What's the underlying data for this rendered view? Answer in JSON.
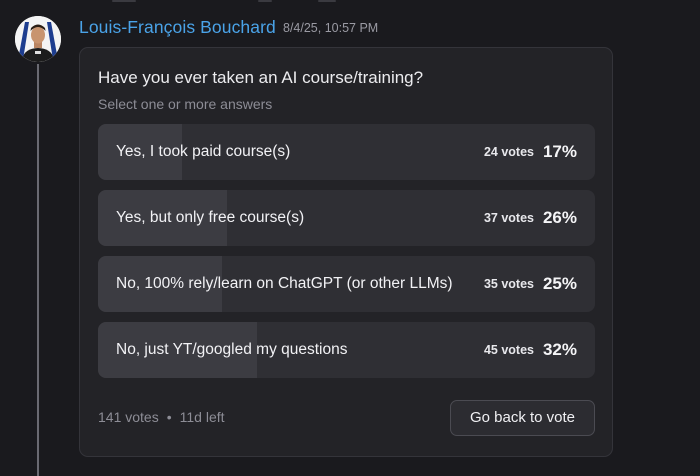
{
  "message": {
    "author": "Louis-François Bouchard",
    "timestamp": "8/4/25, 10:57 PM"
  },
  "poll": {
    "question": "Have you ever taken an AI course/training?",
    "subtitle": "Select one or more answers",
    "options": [
      {
        "label": "Yes, I took paid course(s)",
        "votes": "24 votes",
        "percent": "17%",
        "fill_fraction": 0.17
      },
      {
        "label": "Yes, but only free course(s)",
        "votes": "37 votes",
        "percent": "26%",
        "fill_fraction": 0.26
      },
      {
        "label": "No, 100% rely/learn on ChatGPT (or other LLMs)",
        "votes": "35 votes",
        "percent": "25%",
        "fill_fraction": 0.25
      },
      {
        "label": "No, just YT/googled my questions",
        "votes": "45 votes",
        "percent": "32%",
        "fill_fraction": 0.32
      }
    ],
    "total_votes": "141 votes",
    "separator": "•",
    "time_left": "11d left",
    "back_button_label": "Go back to vote"
  },
  "colors": {
    "author_name": "#4aa3e8",
    "card_background": "#232327",
    "option_background": "#2f2f34",
    "option_fill": "#3c3c42"
  }
}
